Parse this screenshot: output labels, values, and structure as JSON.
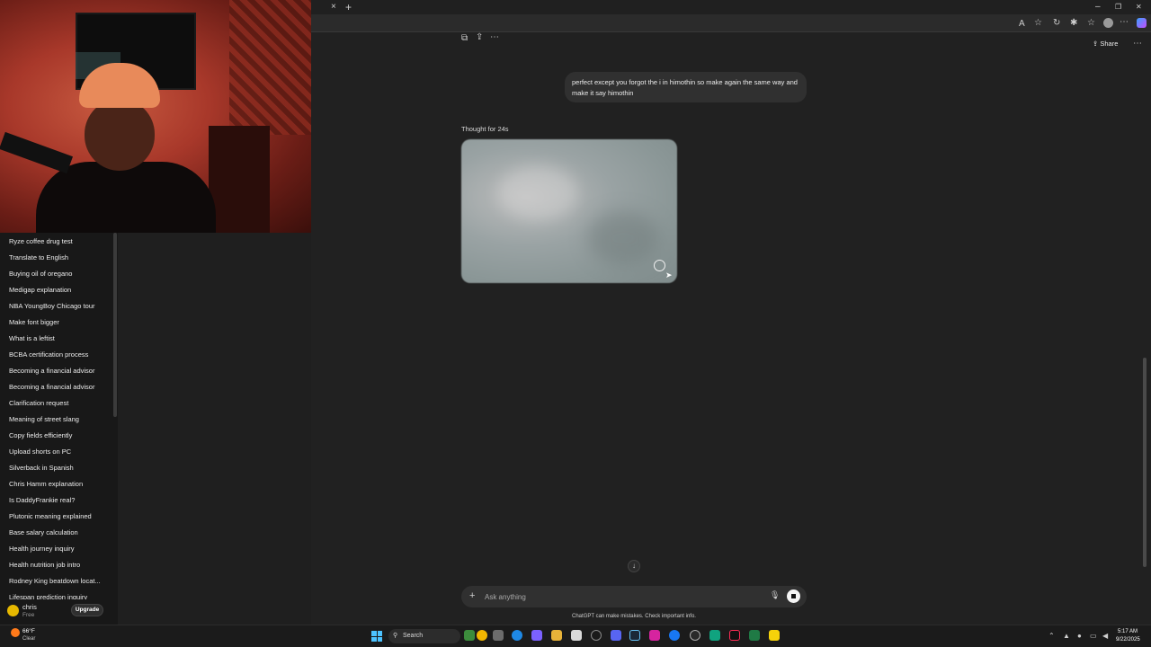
{
  "browser": {
    "tab_close": "×",
    "new_tab": "+",
    "window_min": "–",
    "window_restore": "❐",
    "window_close": "✕"
  },
  "sidebar": {
    "items": [
      "Ryze coffee drug test",
      "Translate to English",
      "Buying oil of oregano",
      "Medigap explanation",
      "NBA YoungBoy Chicago tour",
      "Make font bigger",
      "What is a leftist",
      "BCBA certification process",
      "Becoming a financial advisor",
      "Becoming a financial advisor",
      "Clarification request",
      "Meaning of street slang",
      "Copy fields efficiently",
      "Upload shorts on PC",
      "Silverback in Spanish",
      "Chris Hamm explanation",
      "Is DaddyFrankie real?",
      "Plutonic meaning explained",
      "Base salary calculation",
      "Health journey inquiry",
      "Health nutrition job intro",
      "Rodney King beatdown locat...",
      "Lifespan prediction inquiry"
    ],
    "user": {
      "name": "chris",
      "plan": "Free",
      "upgrade_label": "Upgrade"
    }
  },
  "header": {
    "share_label": "Share",
    "more_label": "⋯"
  },
  "conversation": {
    "user_message": "perfect except you forgot the i in himothin so make again the same way and make it say himothin",
    "thought_label": "Thought for 24s"
  },
  "composer": {
    "placeholder": "Ask anything",
    "disclaimer": "ChatGPT can make mistakes. Check important info."
  },
  "taskbar": {
    "weather_temp": "66°F",
    "weather_desc": "Clear",
    "search_label": "Search",
    "time": "5:17 AM",
    "date": "9/22/2025"
  },
  "colors": {
    "background": "#212121",
    "sidebar": "#181818",
    "user_bubble": "#303030",
    "accent_start": "#4cc2ff"
  }
}
